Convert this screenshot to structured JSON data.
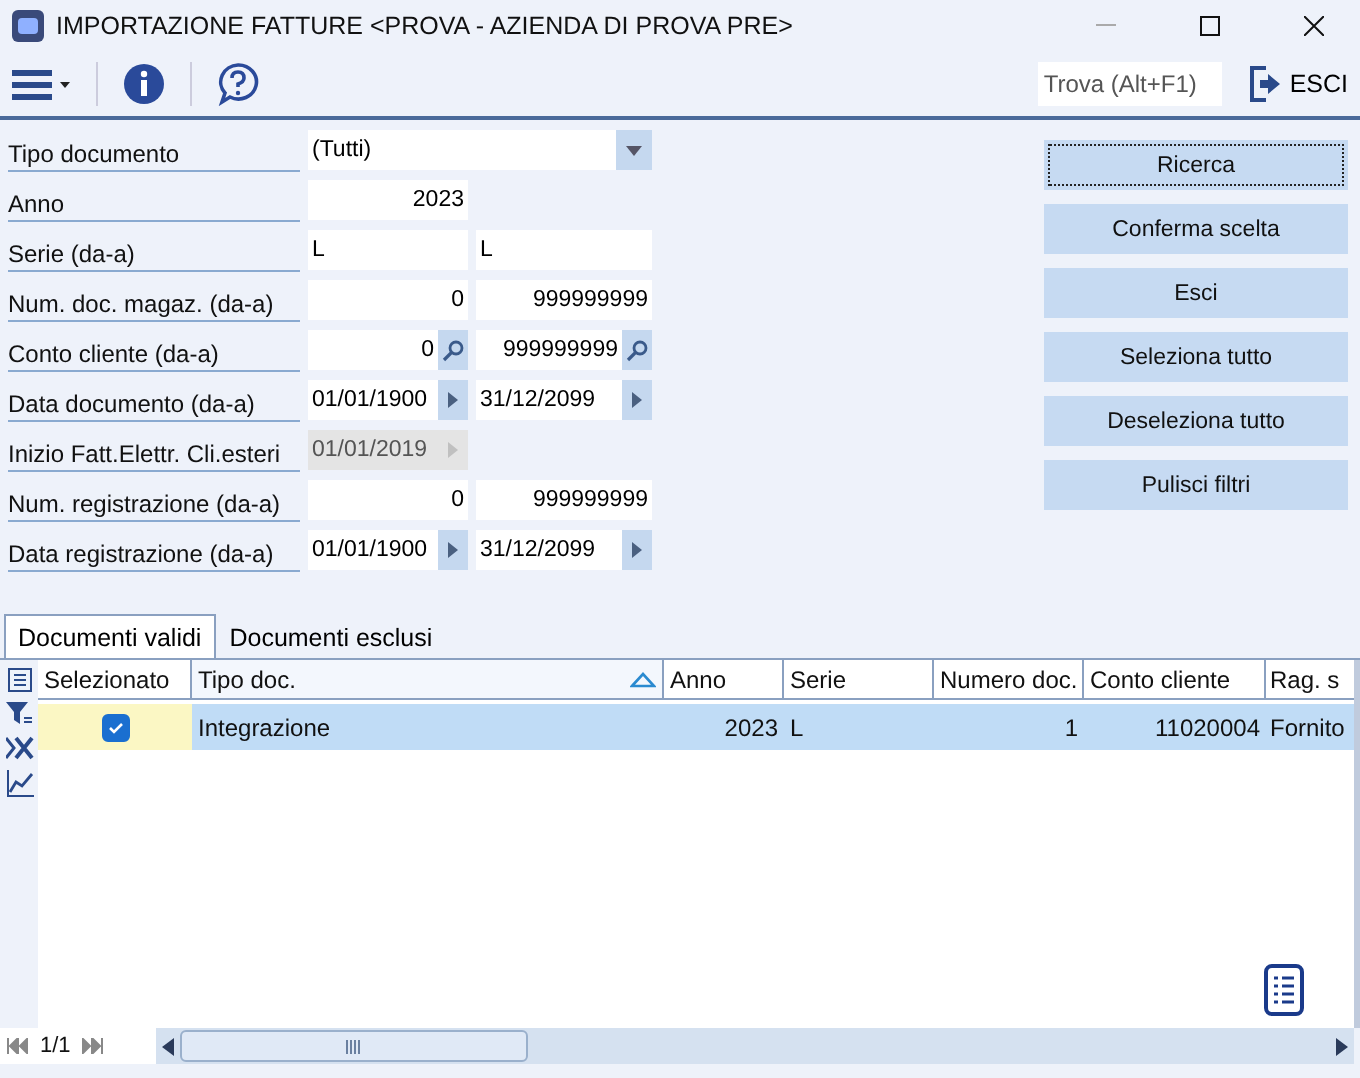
{
  "window": {
    "title": "IMPORTAZIONE FATTURE <PROVA - AZIENDA DI PROVA PRE>"
  },
  "toolbar": {
    "search": {
      "placeholder": "Trova (Alt+F1)"
    },
    "exit_label": "ESCI"
  },
  "form": [
    {
      "label": "Tipo documento",
      "kind": "dropdown",
      "value": "(Tutti)"
    },
    {
      "label": "Anno",
      "kind": "number",
      "value": "2023"
    },
    {
      "label": "Serie (da-a)",
      "kind": "text-range",
      "from": "L",
      "to": "L"
    },
    {
      "label": "Num. doc. magaz. (da-a)",
      "kind": "number-range",
      "from": "0",
      "to": "999999999"
    },
    {
      "label": "Conto cliente (da-a)",
      "kind": "lookup-range",
      "from": "0",
      "to": "999999999"
    },
    {
      "label": "Data documento (da-a)",
      "kind": "date-range",
      "from": "01/01/1900",
      "to": "31/12/2099"
    },
    {
      "label": "Inizio Fatt.Elettr. Cli.esteri",
      "kind": "date",
      "value": "01/01/2019",
      "disabled": true
    },
    {
      "label": "Num. registrazione (da-a)",
      "kind": "number-range",
      "from": "0",
      "to": "999999999"
    },
    {
      "label": "Data registrazione (da-a)",
      "kind": "date-range",
      "from": "01/01/1900",
      "to": "31/12/2099"
    }
  ],
  "buttons": [
    {
      "label": "Ricerca",
      "focused": true
    },
    {
      "label": "Conferma scelta",
      "focused": false
    },
    {
      "label": "Esci",
      "focused": false
    },
    {
      "label": "Seleziona tutto",
      "focused": false
    },
    {
      "label": "Deseleziona tutto",
      "focused": false
    },
    {
      "label": "Pulisci filtri",
      "focused": false
    }
  ],
  "tabs": [
    {
      "label": "Documenti validi",
      "selected": true
    },
    {
      "label": "Documenti esclusi",
      "selected": false
    }
  ],
  "table": {
    "columns": [
      {
        "label": "Selezionato",
        "sorted": false
      },
      {
        "label": "Tipo doc.",
        "sorted": true
      },
      {
        "label": "Anno",
        "sorted": false
      },
      {
        "label": "Serie",
        "sorted": false
      },
      {
        "label": "Numero doc.",
        "sorted": false
      },
      {
        "label": "Conto cliente",
        "sorted": false
      },
      {
        "label": "Rag. s",
        "sorted": false
      }
    ],
    "rows": [
      {
        "checked": true,
        "selected": true,
        "cells": [
          "",
          "Integrazione",
          "2023",
          "L",
          "1",
          "11020004",
          "Fornito"
        ]
      }
    ]
  },
  "pager": {
    "page": "1/1"
  }
}
